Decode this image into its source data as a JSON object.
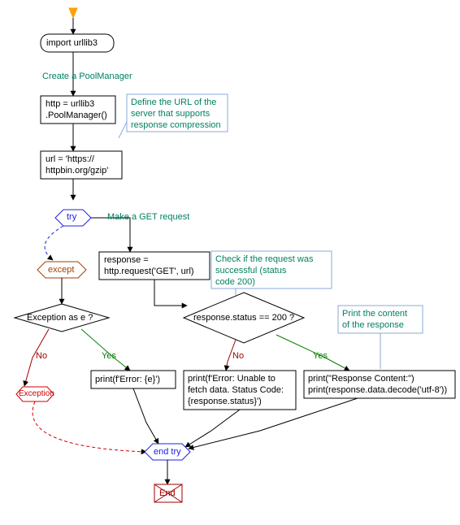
{
  "nodes": {
    "import": "import urllib3",
    "pool": "http = urllib3\n.PoolManager()",
    "url": "url = 'https://\nhttpbin.org/gzip'",
    "try": "try",
    "except": "except",
    "request": "response =\nhttp.request('GET', url)",
    "exc_as_e": "Exception as e ?",
    "status200": "response.status == 200 ?",
    "exception": "Exception",
    "print_err": "print(f'Error: {e}')",
    "print_fail": "print(f'Error: Unable to\nfetch data. Status Code:\n{response.status}')",
    "print_ok": "print(\"Response Content:\")\nprint(response.data.decode('utf-8'))",
    "endtry": "end try",
    "end": "End"
  },
  "annotations": {
    "create_pool": "Create a PoolManager",
    "define_url": "Define the URL of the\nserver that supports\nresponse compression",
    "make_get": "Make a GET request",
    "check_status": "Check if the request was\nsuccessful (status\ncode 200)",
    "print_content": "Print the content\nof the response"
  },
  "edges": {
    "yes": "Yes",
    "no": "No"
  },
  "chart_data": {
    "type": "flowchart",
    "title": "",
    "nodes": [
      {
        "id": "start",
        "kind": "start",
        "label": ""
      },
      {
        "id": "import",
        "kind": "process",
        "label": "import urllib3"
      },
      {
        "id": "pool",
        "kind": "process",
        "label": "http = urllib3.PoolManager()",
        "annotation": "Create a PoolManager"
      },
      {
        "id": "url",
        "kind": "process",
        "label": "url = 'https://httpbin.org/gzip'",
        "annotation": "Define the URL of the server that supports response compression"
      },
      {
        "id": "try",
        "kind": "try",
        "label": "try",
        "annotation": "Make a GET request"
      },
      {
        "id": "except",
        "kind": "except",
        "label": "except"
      },
      {
        "id": "request",
        "kind": "process",
        "label": "response = http.request('GET', url)"
      },
      {
        "id": "status200",
        "kind": "decision",
        "label": "response.status == 200 ?",
        "annotation": "Check if the request was successful (status code 200)"
      },
      {
        "id": "print_ok",
        "kind": "process",
        "label": "print(\"Response Content:\"); print(response.data.decode('utf-8'))",
        "annotation": "Print the content of the response"
      },
      {
        "id": "print_fail",
        "kind": "process",
        "label": "print(f'Error: Unable to fetch data. Status Code: {response.status}')"
      },
      {
        "id": "exc_as_e",
        "kind": "decision",
        "label": "Exception as e ?"
      },
      {
        "id": "print_err",
        "kind": "process",
        "label": "print(f'Error: {e}')"
      },
      {
        "id": "exception",
        "kind": "terminator",
        "label": "Exception"
      },
      {
        "id": "endtry",
        "kind": "endtry",
        "label": "end try"
      },
      {
        "id": "end",
        "kind": "end",
        "label": "End"
      }
    ],
    "edges": [
      {
        "from": "start",
        "to": "import"
      },
      {
        "from": "import",
        "to": "pool"
      },
      {
        "from": "pool",
        "to": "url"
      },
      {
        "from": "url",
        "to": "try"
      },
      {
        "from": "try",
        "to": "request"
      },
      {
        "from": "try",
        "to": "except",
        "style": "dashed"
      },
      {
        "from": "request",
        "to": "status200"
      },
      {
        "from": "status200",
        "to": "print_ok",
        "label": "Yes"
      },
      {
        "from": "status200",
        "to": "print_fail",
        "label": "No"
      },
      {
        "from": "except",
        "to": "exc_as_e"
      },
      {
        "from": "exc_as_e",
        "to": "print_err",
        "label": "Yes"
      },
      {
        "from": "exc_as_e",
        "to": "exception",
        "label": "No"
      },
      {
        "from": "print_ok",
        "to": "endtry"
      },
      {
        "from": "print_fail",
        "to": "endtry"
      },
      {
        "from": "print_err",
        "to": "endtry"
      },
      {
        "from": "exception",
        "to": "endtry",
        "style": "dashed"
      },
      {
        "from": "endtry",
        "to": "end"
      }
    ]
  }
}
